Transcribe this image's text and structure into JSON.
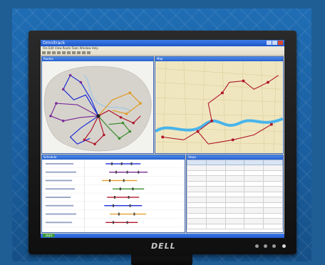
{
  "brand": "DELL",
  "app": {
    "title": "Omnitrack",
    "menu": "File  Edit  View  Route  Tools  Window  Help"
  },
  "panes": {
    "map_left_title": "Routes",
    "map_right_title": "Map",
    "gantt_title": "Schedule",
    "table_title": "Stops"
  },
  "colors": {
    "desktop": "#1f5d95",
    "river": "#48b4ea",
    "route_red": "#b0162a",
    "route_blue": "#1b2bd6",
    "route_purple": "#7a2b9a",
    "route_orange": "#e09a22",
    "route_green": "#3a8c2e"
  },
  "table": {
    "headers": [
      "",
      "",
      "",
      "",
      ""
    ],
    "rows": [
      [
        "",
        "",
        "",
        "",
        ""
      ],
      [
        "",
        "",
        "",
        "",
        ""
      ],
      [
        "",
        "",
        "",
        "",
        ""
      ],
      [
        "",
        "",
        "",
        "",
        ""
      ],
      [
        "",
        "",
        "",
        "",
        ""
      ],
      [
        "",
        "",
        "",
        "",
        ""
      ],
      [
        "",
        "",
        "",
        "",
        ""
      ],
      [
        "",
        "",
        "",
        "",
        ""
      ],
      [
        "",
        "",
        "",
        "",
        ""
      ],
      [
        "",
        "",
        "",
        "",
        ""
      ],
      [
        "",
        "",
        "",
        "",
        ""
      ],
      [
        "",
        "",
        "",
        "",
        ""
      ]
    ]
  },
  "taskbar": {
    "start": "start"
  }
}
